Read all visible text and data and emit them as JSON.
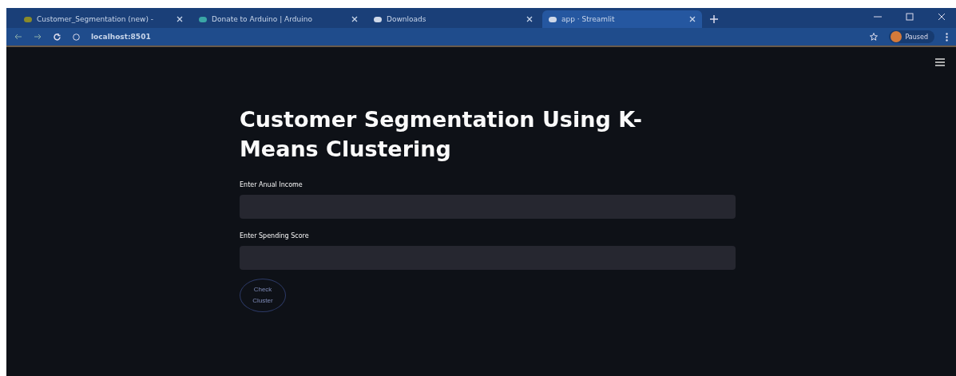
{
  "browser": {
    "tabs": [
      {
        "title": "Customer_Segmentation (new) -",
        "selected": false
      },
      {
        "title": "Donate to Arduino | Arduino",
        "selected": false
      },
      {
        "title": "Downloads",
        "selected": false
      },
      {
        "title": "app · Streamlit",
        "selected": true
      }
    ],
    "address": "localhost:8501",
    "profile": "Paused"
  },
  "page": {
    "title": "Customer Segmentation Using K-Means Clustering",
    "fields": [
      {
        "label": "Enter Anual Income"
      },
      {
        "label": "Enter Spending Score"
      }
    ],
    "button": "Check Cluster"
  }
}
